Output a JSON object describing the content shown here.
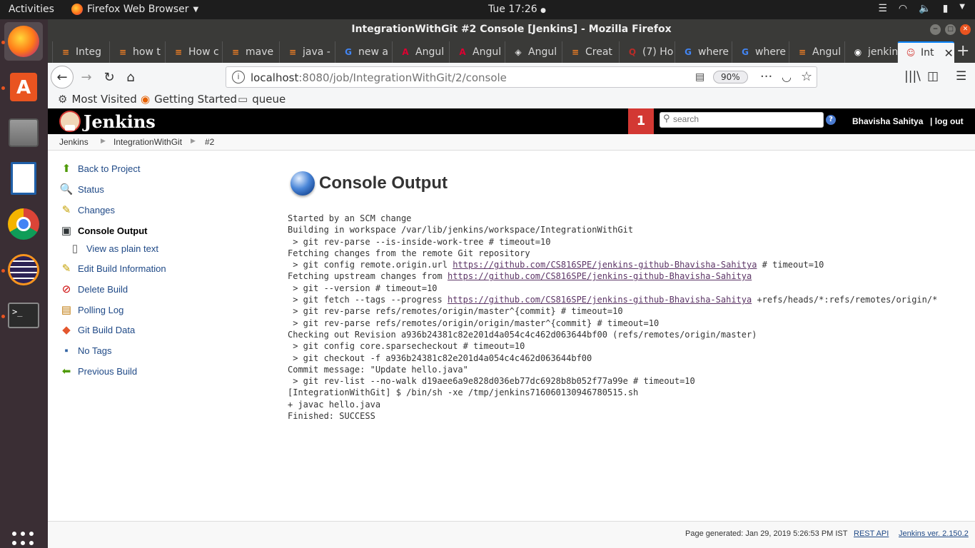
{
  "topbar": {
    "activities": "Activities",
    "app_name": "Firefox Web Browser",
    "clock": "Tue 17:26"
  },
  "window": {
    "title": "IntegrationWithGit #2 Console [Jenkins] - Mozilla Firefox"
  },
  "tabs": [
    {
      "label": "Integ",
      "icon": "stackoverflow-icon",
      "color": "#f48024"
    },
    {
      "label": "how t",
      "icon": "stackoverflow-icon",
      "color": "#f48024"
    },
    {
      "label": "How c",
      "icon": "stackoverflow-icon",
      "color": "#f48024"
    },
    {
      "label": "mave",
      "icon": "stackoverflow-icon",
      "color": "#f48024"
    },
    {
      "label": "java -",
      "icon": "stackoverflow-icon",
      "color": "#f48024"
    },
    {
      "label": "new a",
      "icon": "google-icon",
      "color": "#4285f4"
    },
    {
      "label": "Angul",
      "icon": "angular-icon",
      "color": "#dd0031"
    },
    {
      "label": "Angul",
      "icon": "angular-icon",
      "color": "#dd0031"
    },
    {
      "label": "Angul",
      "icon": "angular-outline-icon",
      "color": "#dddddd"
    },
    {
      "label": "Creat",
      "icon": "stackoverflow-icon",
      "color": "#f48024"
    },
    {
      "label": "(7) Ho",
      "icon": "quora-icon",
      "color": "#b92b27"
    },
    {
      "label": "where",
      "icon": "google-icon",
      "color": "#4285f4"
    },
    {
      "label": "where",
      "icon": "google-icon",
      "color": "#4285f4"
    },
    {
      "label": "Angul",
      "icon": "stackoverflow-icon",
      "color": "#f48024"
    },
    {
      "label": "jenkin",
      "icon": "github-icon",
      "color": "#ffffff"
    },
    {
      "label": "Int",
      "icon": "jenkins-icon",
      "color": "#d33833",
      "active": true
    }
  ],
  "urlbar": {
    "host": "localhost",
    "rest": ":8080/job/IntegrationWithGit/2/console",
    "zoom": "90%"
  },
  "bookmarks": [
    {
      "label": "Most Visited",
      "icon": "gear-icon"
    },
    {
      "label": "Getting Started",
      "icon": "firefox-icon"
    },
    {
      "label": "queue",
      "icon": "folder-icon"
    }
  ],
  "jenkins": {
    "logo_text": "Jenkins",
    "notification_count": "1",
    "search_placeholder": "search",
    "user": "Bhavisha Sahitya",
    "logout": "| log out",
    "breadcrumbs": [
      "Jenkins",
      "IntegrationWithGit",
      "#2"
    ]
  },
  "sidebar": [
    {
      "label": "Back to Project",
      "icon": "up-arrow-icon"
    },
    {
      "label": "Status",
      "icon": "magnifier-icon"
    },
    {
      "label": "Changes",
      "icon": "notepad-icon"
    },
    {
      "label": "Console Output",
      "icon": "terminal-icon",
      "current": true
    },
    {
      "label": "View as plain text",
      "icon": "document-icon",
      "sub": true
    },
    {
      "label": "Edit Build Information",
      "icon": "notepad-icon"
    },
    {
      "label": "Delete Build",
      "icon": "no-entry-icon"
    },
    {
      "label": "Polling Log",
      "icon": "clipboard-icon"
    },
    {
      "label": "Git Build Data",
      "icon": "git-icon"
    },
    {
      "label": "No Tags",
      "icon": "save-disk-icon"
    },
    {
      "label": "Previous Build",
      "icon": "left-arrow-icon"
    }
  ],
  "console": {
    "title": "Console Output",
    "lines": [
      {
        "text": "Started by an SCM change"
      },
      {
        "text": "Building in workspace /var/lib/jenkins/workspace/IntegrationWithGit"
      },
      {
        "text": " > git rev-parse --is-inside-work-tree # timeout=10"
      },
      {
        "text": "Fetching changes from the remote Git repository"
      },
      {
        "pre": " > git config remote.origin.url ",
        "link": "https://github.com/CS816SPE/jenkins-github-Bhavisha-Sahitya",
        "post": " # timeout=10"
      },
      {
        "pre": "Fetching upstream changes from ",
        "link": "https://github.com/CS816SPE/jenkins-github-Bhavisha-Sahitya",
        "post": ""
      },
      {
        "text": " > git --version # timeout=10"
      },
      {
        "pre": " > git fetch --tags --progress ",
        "link": "https://github.com/CS816SPE/jenkins-github-Bhavisha-Sahitya",
        "post": " +refs/heads/*:refs/remotes/origin/*"
      },
      {
        "text": " > git rev-parse refs/remotes/origin/master^{commit} # timeout=10"
      },
      {
        "text": " > git rev-parse refs/remotes/origin/origin/master^{commit} # timeout=10"
      },
      {
        "text": "Checking out Revision a936b24381c82e201d4a054c4c462d063644bf00 (refs/remotes/origin/master)"
      },
      {
        "text": " > git config core.sparsecheckout # timeout=10"
      },
      {
        "text": " > git checkout -f a936b24381c82e201d4a054c4c462d063644bf00"
      },
      {
        "text": "Commit message: \"Update hello.java\""
      },
      {
        "text": " > git rev-list --no-walk d19aee6a9e828d036eb77dc6928b8b052f77a99e # timeout=10"
      },
      {
        "text": "[IntegrationWithGit] $ /bin/sh -xe /tmp/jenkins716060130946780515.sh"
      },
      {
        "text": "+ javac hello.java"
      },
      {
        "text": "Finished: SUCCESS"
      }
    ]
  },
  "footer": {
    "generated": "Page generated: Jan 29, 2019 5:26:53 PM IST",
    "rest_api": "REST API",
    "version": "Jenkins ver. 2.150.2"
  }
}
